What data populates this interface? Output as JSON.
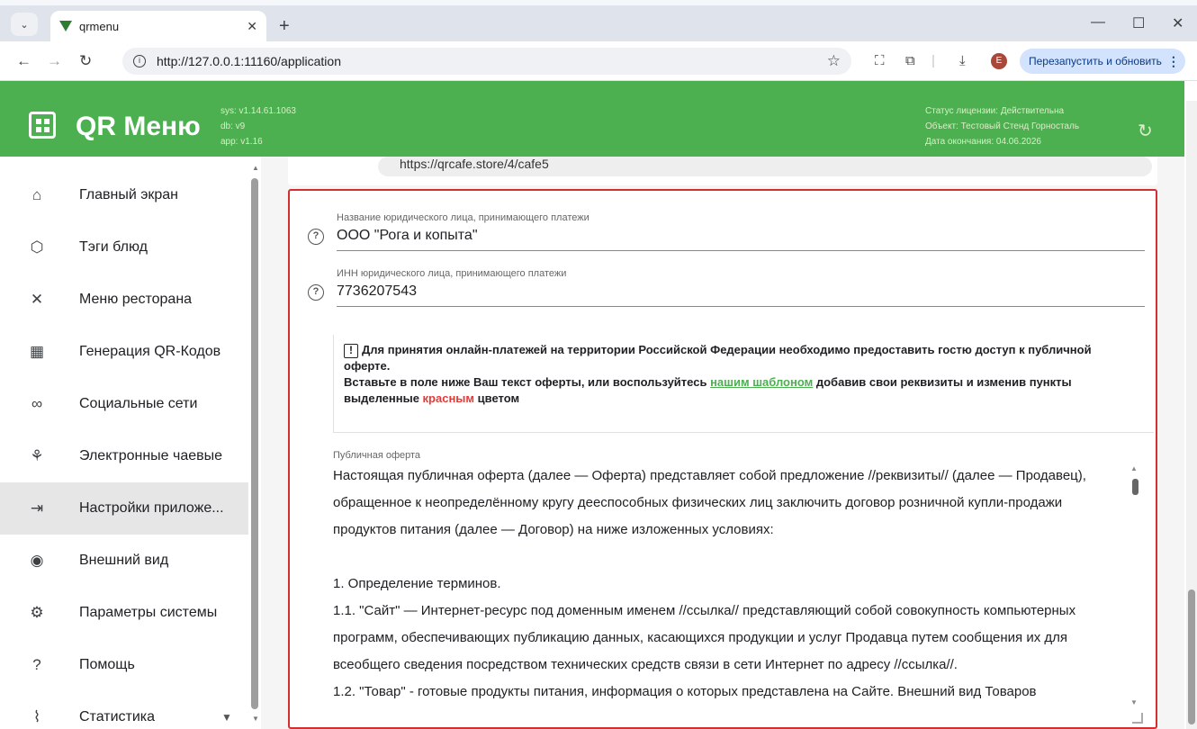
{
  "browser": {
    "tab_title": "qrmenu",
    "tab_close": "✕",
    "new_tab": "+",
    "url": "http://127.0.0.1:11160/application",
    "avatar_letter": "E",
    "restart_label": "Перезапустить и обновить",
    "window_controls": {
      "minimize": "—",
      "maximize": "☐",
      "close": "✕"
    }
  },
  "header": {
    "brand": "QR Меню",
    "version_sys": "sys: v1.14.61.1063",
    "version_db": "db: v9",
    "version_app": "app: v1.16",
    "license_status": "Статус лицензии: Действительна",
    "license_object": "Объект: Тестовый Стенд Горносталь",
    "license_expiry": "Дата окончания: 04.06.2026",
    "accent_color": "#4caf50"
  },
  "sidebar": {
    "items": [
      {
        "label": "Главный экран",
        "icon": "⌂"
      },
      {
        "label": "Тэги блюд",
        "icon": "⬡"
      },
      {
        "label": "Меню ресторана",
        "icon": "✕"
      },
      {
        "label": "Генерация QR-Кодов",
        "icon": "▦"
      },
      {
        "label": "Социальные сети",
        "icon": "∞"
      },
      {
        "label": "Электронные чаевые",
        "icon": "⚘"
      },
      {
        "label": "Настройки приложе...",
        "icon": "⇥"
      },
      {
        "label": "Внешний вид",
        "icon": "◉"
      },
      {
        "label": "Параметры системы",
        "icon": "⚙"
      },
      {
        "label": "Помощь",
        "icon": "?"
      },
      {
        "label": "Статистика",
        "icon": "⌇"
      }
    ],
    "active_index": 6
  },
  "content": {
    "top_pill_text": "https://qrcafe.store/4/cafe5",
    "legal_name_label": "Название юридического лица, принимающего платежи",
    "legal_name_value": "ООО \"Рога и копыта\"",
    "inn_label": "ИНН юридического лица, принимающего платежи",
    "inn_value": "7736207543",
    "notice_icon": "!",
    "notice_line1": "Для принятия онлайн-платежей на территории Российской Федерации необходимо предоставить гостю доступ к публичной оферте.",
    "notice_line2_a": "Вставьте в поле ниже Ваш текст оферты, или воспользуйтесь ",
    "notice_link": "нашим шаблоном",
    "notice_line2_b": " добавив свои реквизиты и изменив пункты выделенные ",
    "notice_red": "красным",
    "notice_line2_c": " цветом",
    "offer_label": "Публичная оферта",
    "offer_text": "Настоящая публичная оферта (далее — Оферта) представляет собой предложение //реквизиты// (далее — Продавец), обращенное к неопределённому кругу дееспособных физических лиц заключить договор розничной купли-продажи продуктов питания (далее — Договор) на ниже изложенных условиях:\n\n1. Определение терминов.\n1.1. \"Сайт\" — Интернет-ресурс под доменным именем //ссылка// представляющий собой совокупность компьютерных программ, обеспечивающих публикацию данных, касающихся продукции и услуг Продавца путем сообщения их для всеобщего сведения посредством технических средств связи в сети Интернет по адресу //ссылка//.\n1.2. \"Товар\" - готовые продукты питания, информация о которых представлена на Сайте. Внешний вид Товаров"
  }
}
